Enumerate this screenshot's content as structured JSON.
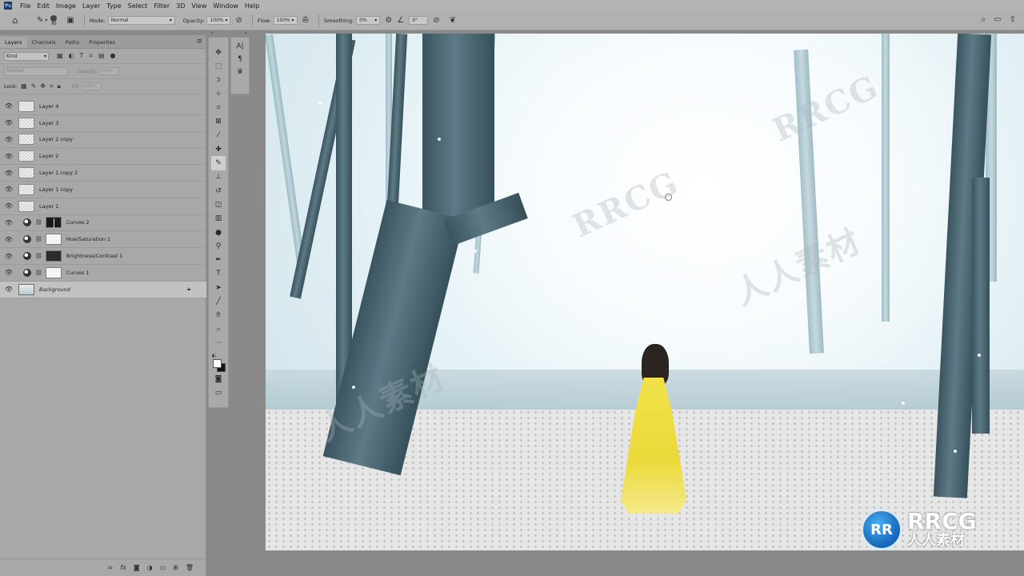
{
  "menubar": {
    "logo": "Ps",
    "items": [
      "File",
      "Edit",
      "Image",
      "Layer",
      "Type",
      "Select",
      "Filter",
      "3D",
      "View",
      "Window",
      "Help"
    ]
  },
  "options": {
    "brush_size": "80",
    "mode_label": "Mode:",
    "mode_value": "Normal",
    "opacity_label": "Opacity:",
    "opacity_value": "100%",
    "flow_label": "Flow:",
    "flow_value": "100%",
    "smoothing_label": "Smoothing:",
    "smoothing_value": "0%",
    "angle_value": "0°"
  },
  "panel": {
    "tabs": [
      "Layers",
      "Channels",
      "Paths",
      "Properties"
    ],
    "kind_label": "Kind",
    "blend_mode": "Normal",
    "opacity_label": "Opacity:",
    "opacity_value": "100%",
    "lock_label": "Lock:",
    "fill_label": "Fill:",
    "fill_value": "100%"
  },
  "layers": [
    {
      "name": "Layer 4",
      "type": "pixel"
    },
    {
      "name": "Layer 3",
      "type": "pixel"
    },
    {
      "name": "Layer 2 copy",
      "type": "pixel"
    },
    {
      "name": "Layer 2",
      "type": "pixel"
    },
    {
      "name": "Layer 1 copy 2",
      "type": "pixel"
    },
    {
      "name": "Layer 1 copy",
      "type": "pixel"
    },
    {
      "name": "Layer 1",
      "type": "pixel"
    },
    {
      "name": "Curves 2",
      "type": "adjustment",
      "mask": "curve"
    },
    {
      "name": "Hue/Saturation 1",
      "type": "adjustment",
      "mask": "white"
    },
    {
      "name": "Brightness/Contrast 1",
      "type": "adjustment",
      "mask": "dark"
    },
    {
      "name": "Curves 1",
      "type": "adjustment",
      "mask": "white"
    },
    {
      "name": "Background",
      "type": "background"
    }
  ],
  "watermark": {
    "brand": "RRCG",
    "cn": "人人素材",
    "badge": "RR"
  },
  "colors": {
    "foreground": "#ffffff",
    "background": "#111111",
    "dress": "#f1e24a"
  }
}
